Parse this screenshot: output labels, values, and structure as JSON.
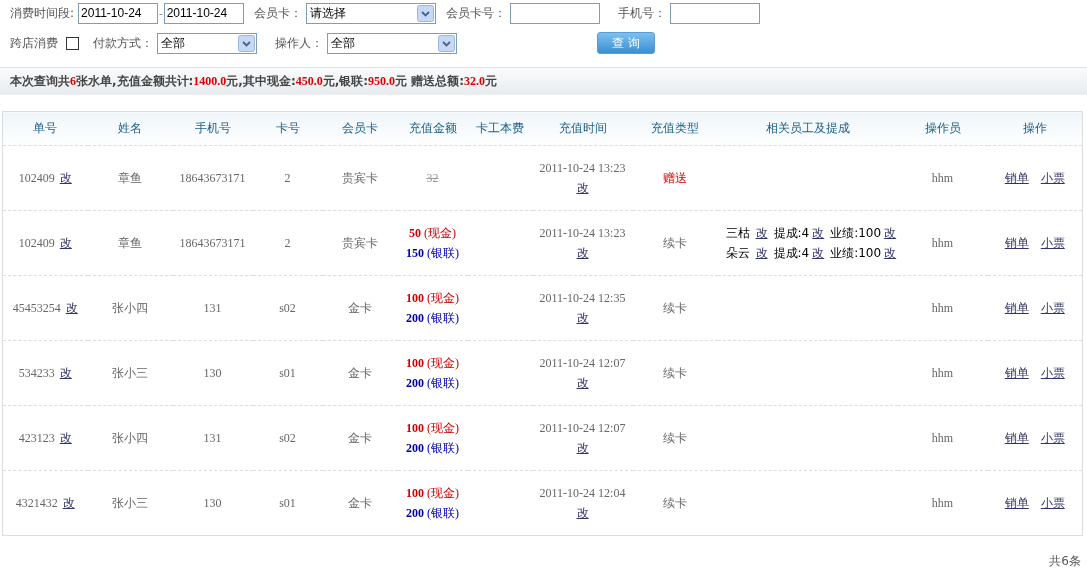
{
  "filters": {
    "date_label": "消费时间段:",
    "date_from": "2011-10-24",
    "date_separator": "-",
    "date_to": "2011-10-24",
    "card_label": "会员卡：",
    "card_select": "请选择",
    "card_no_label": "会员卡号：",
    "phone_label": "手机号：",
    "cross_store_label": "跨店消费",
    "cross_store_checked": false,
    "payment_label": "付款方式：",
    "payment_select": "全部",
    "operator_label": "操作人：",
    "operator_select": "全部",
    "query_button": "查 询"
  },
  "summary": [
    {
      "kind": "label",
      "text": "本次查询共"
    },
    {
      "kind": "value",
      "text": "6"
    },
    {
      "kind": "label",
      "text": "张水单,充值金额共计:"
    },
    {
      "kind": "value",
      "text": "1400.0"
    },
    {
      "kind": "label",
      "text": "元,其中现金:"
    },
    {
      "kind": "value",
      "text": "450.0"
    },
    {
      "kind": "label",
      "text": "元,银联:"
    },
    {
      "kind": "value",
      "text": "950.0"
    },
    {
      "kind": "label",
      "text": "元  赠送总额:"
    },
    {
      "kind": "value",
      "text": "32.0"
    },
    {
      "kind": "label",
      "text": "元"
    }
  ],
  "table": {
    "columns": [
      "单号",
      "姓名",
      "手机号",
      "卡号",
      "会员卡",
      "充值金额",
      "卡工本费",
      "充值时间",
      "充值类型",
      "相关员工及提成",
      "操作员",
      "操作"
    ],
    "rows": [
      {
        "order_no": "102409",
        "order_edit": "改",
        "name": "章鱼",
        "phone": "18643673171",
        "card_no": "2",
        "card_type": "贵宾卡",
        "amounts": [
          {
            "kind": "struck",
            "amount": "32"
          }
        ],
        "time": "2011-10-24 13:23",
        "time_edit": "改",
        "type": {
          "kind": "gift",
          "text": "赠送"
        },
        "staff": [],
        "operator": "hhm",
        "actions": [
          "销单",
          "小票"
        ]
      },
      {
        "order_no": "102409",
        "order_edit": "改",
        "name": "章鱼",
        "phone": "18643673171",
        "card_no": "2",
        "card_type": "贵宾卡",
        "amounts": [
          {
            "kind": "cash",
            "amount": "50",
            "method": "(现金)"
          },
          {
            "kind": "unionpay",
            "amount": "150",
            "method": "(银联)"
          }
        ],
        "time": "2011-10-24 13:23",
        "time_edit": "改",
        "type": {
          "kind": "renew",
          "text": "续卡"
        },
        "staff": [
          {
            "name": "三枯",
            "edit": "改",
            "commission": "提成:4",
            "commission_edit": "改",
            "performance": "业绩:100",
            "performance_edit": "改"
          },
          {
            "name": "朵云",
            "edit": "改",
            "commission": "提成:4",
            "commission_edit": "改",
            "performance": "业绩:100",
            "performance_edit": "改"
          }
        ],
        "operator": "hhm",
        "actions": [
          "销单",
          "小票"
        ]
      },
      {
        "order_no": "45453254",
        "order_edit": "改",
        "name": "张小四",
        "phone": "131",
        "card_no": "s02",
        "card_type": "金卡",
        "amounts": [
          {
            "kind": "cash",
            "amount": "100",
            "method": "(现金)"
          },
          {
            "kind": "unionpay",
            "amount": "200",
            "method": "(银联)"
          }
        ],
        "time": "2011-10-24 12:35",
        "time_edit": "改",
        "type": {
          "kind": "renew",
          "text": "续卡"
        },
        "staff": [],
        "operator": "hhm",
        "actions": [
          "销单",
          "小票"
        ]
      },
      {
        "order_no": "534233",
        "order_edit": "改",
        "name": "张小三",
        "phone": "130",
        "card_no": "s01",
        "card_type": "金卡",
        "amounts": [
          {
            "kind": "cash",
            "amount": "100",
            "method": "(现金)"
          },
          {
            "kind": "unionpay",
            "amount": "200",
            "method": "(银联)"
          }
        ],
        "time": "2011-10-24 12:07",
        "time_edit": "改",
        "type": {
          "kind": "renew",
          "text": "续卡"
        },
        "staff": [],
        "operator": "hhm",
        "actions": [
          "销单",
          "小票"
        ]
      },
      {
        "order_no": "423123",
        "order_edit": "改",
        "name": "张小四",
        "phone": "131",
        "card_no": "s02",
        "card_type": "金卡",
        "amounts": [
          {
            "kind": "cash",
            "amount": "100",
            "method": "(现金)"
          },
          {
            "kind": "unionpay",
            "amount": "200",
            "method": "(银联)"
          }
        ],
        "time": "2011-10-24 12:07",
        "time_edit": "改",
        "type": {
          "kind": "renew",
          "text": "续卡"
        },
        "staff": [],
        "operator": "hhm",
        "actions": [
          "销单",
          "小票"
        ]
      },
      {
        "order_no": "4321432",
        "order_edit": "改",
        "name": "张小三",
        "phone": "130",
        "card_no": "s01",
        "card_type": "金卡",
        "amounts": [
          {
            "kind": "cash",
            "amount": "100",
            "method": "(现金)"
          },
          {
            "kind": "unionpay",
            "amount": "200",
            "method": "(银联)"
          }
        ],
        "time": "2011-10-24 12:04",
        "time_edit": "改",
        "type": {
          "kind": "renew",
          "text": "续卡"
        },
        "staff": [],
        "operator": "hhm",
        "actions": [
          "销单",
          "小票"
        ]
      }
    ]
  },
  "footer": "共6条"
}
